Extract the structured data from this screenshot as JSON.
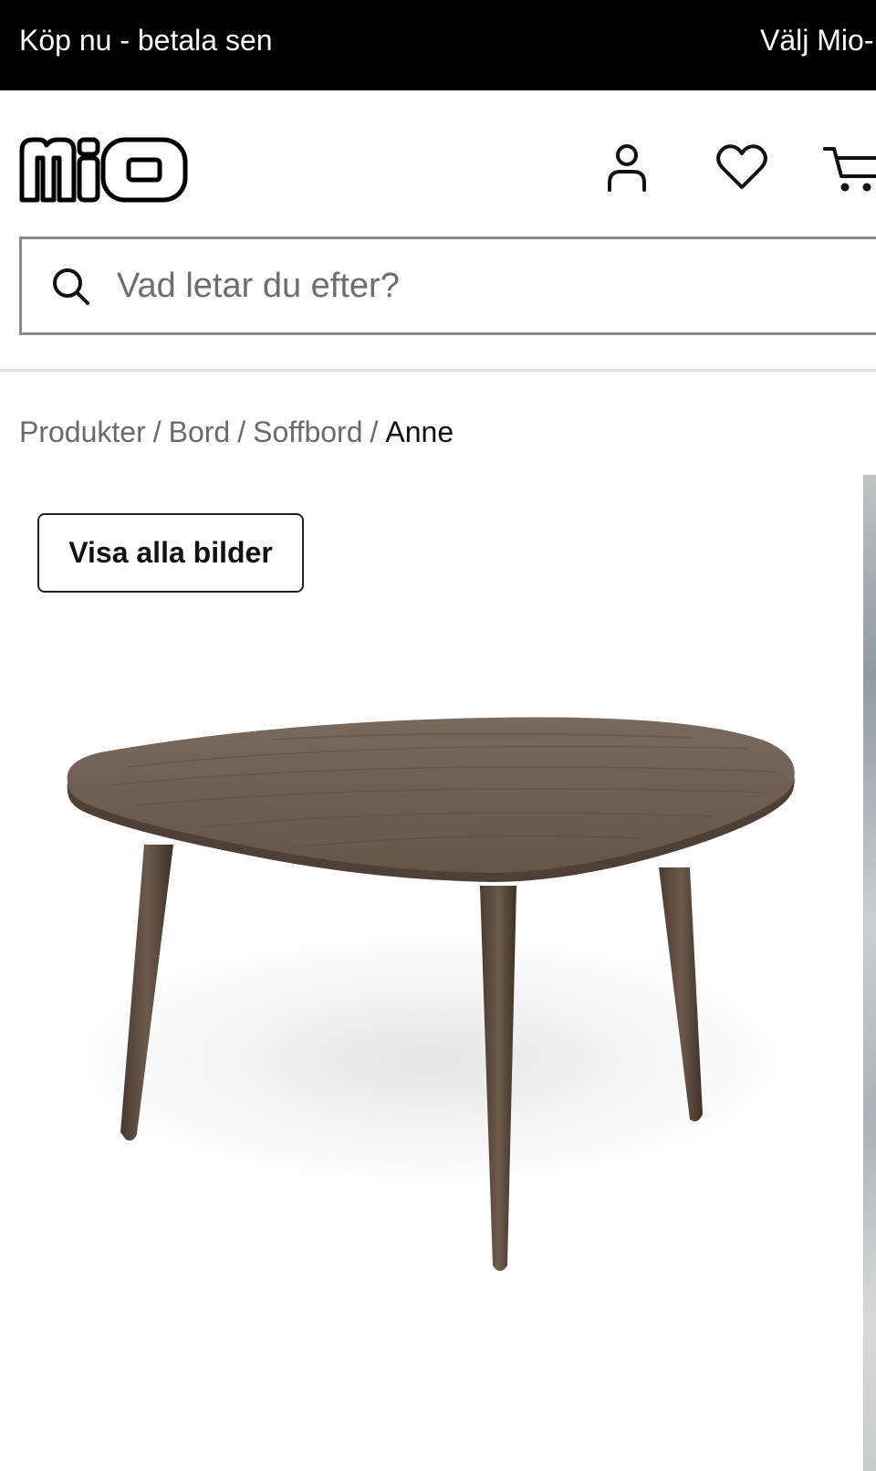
{
  "promo_bar": {
    "left_text": "Köp nu - betala sen",
    "right_text": "Välj Mio-"
  },
  "header": {
    "logo_text": "mio",
    "icons": [
      "user-icon",
      "heart-icon",
      "cart-icon"
    ]
  },
  "search": {
    "placeholder": "Vad letar du efter?"
  },
  "breadcrumb": {
    "items": [
      "Produkter",
      "Bord",
      "Soffbord",
      "Anne"
    ],
    "separator": "/"
  },
  "gallery": {
    "view_all_label": "Visa alla bilder"
  },
  "colors": {
    "promo_bg": "#000000",
    "table_wood": "#6b5a4e"
  }
}
